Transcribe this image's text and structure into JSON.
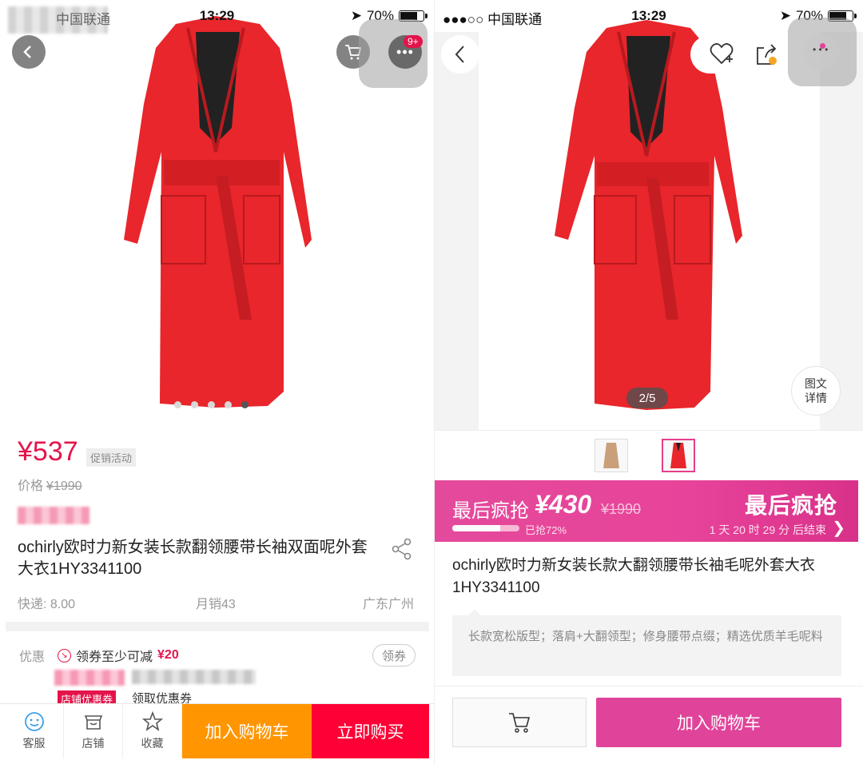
{
  "left": {
    "status": {
      "carrier": "中国联通",
      "time": "13:29",
      "battery": "70%"
    },
    "cart_badge": "9+",
    "gallery": {
      "dots": 5,
      "active_dot": 4
    },
    "price": "¥537",
    "promo_tag": "促销活动",
    "orig_price_label": "价格",
    "orig_price": "¥1990",
    "title": "ochirly欧时力新女装长款翻领腰带长袖双面呢外套大衣1HY3341100",
    "shipping": "快递: 8.00",
    "monthly_sales": "月销43",
    "location": "广东广州",
    "coupon": {
      "label": "优惠",
      "text": "领券至少可减",
      "amount": "¥20",
      "button": "领券",
      "shop_tag": "店铺优惠券",
      "shop_get": "领取优惠券"
    },
    "bottom": {
      "service": "客服",
      "shop": "店铺",
      "favorite": "收藏",
      "add_to_cart": "加入购物车",
      "buy_now": "立即购买"
    },
    "colors": {
      "price": "#e4144b",
      "cart_btn": "#ff9500",
      "buy_btn": "#ff0036"
    }
  },
  "right": {
    "status": {
      "carrier": "●●●○○ 中国联通",
      "time": "13:29",
      "battery": "70%"
    },
    "page_indicator": "2/5",
    "detail_btn": {
      "line1": "图文",
      "line2": "详情"
    },
    "flash": {
      "label": "最后疯抢",
      "price": "¥430",
      "orig_price": "¥1990",
      "grabbed": "已抢72%",
      "progress_pct": 72,
      "big_title": "最后疯抢",
      "countdown": "1 天 20 时 29 分 后结束"
    },
    "title": "ochirly欧时力新女装长款大翻领腰带长袖毛呢外套大衣1HY3341100",
    "desc": "长款宽松版型；落肩+大翻领型；修身腰带点缀；精选优质羊毛呢料",
    "add_to_cart": "加入购物车",
    "colors": {
      "accent": "#e0449a"
    }
  }
}
